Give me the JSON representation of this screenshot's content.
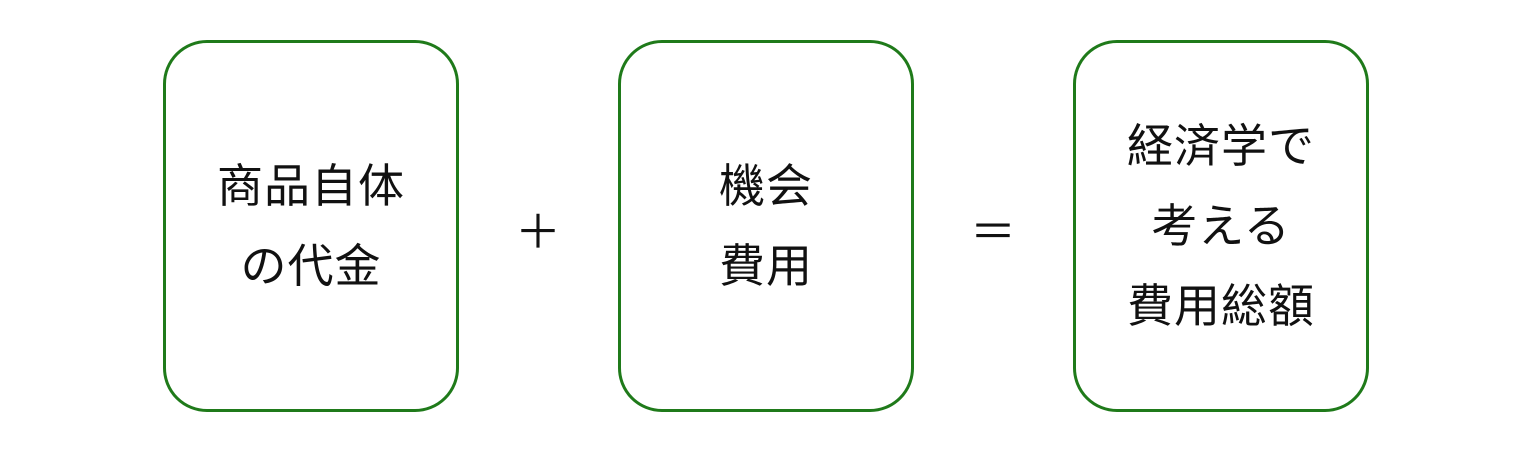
{
  "colors": {
    "box_border": "#1f7a1a",
    "text": "#111111",
    "background": "#ffffff"
  },
  "boxes": [
    {
      "lines": [
        "商品自体",
        "の代金"
      ]
    },
    {
      "lines": [
        "機会",
        "費用"
      ]
    },
    {
      "lines": [
        "経済学で",
        "考える",
        "費用総額"
      ]
    }
  ],
  "operators": {
    "plus": "＋",
    "equals": "＝"
  }
}
